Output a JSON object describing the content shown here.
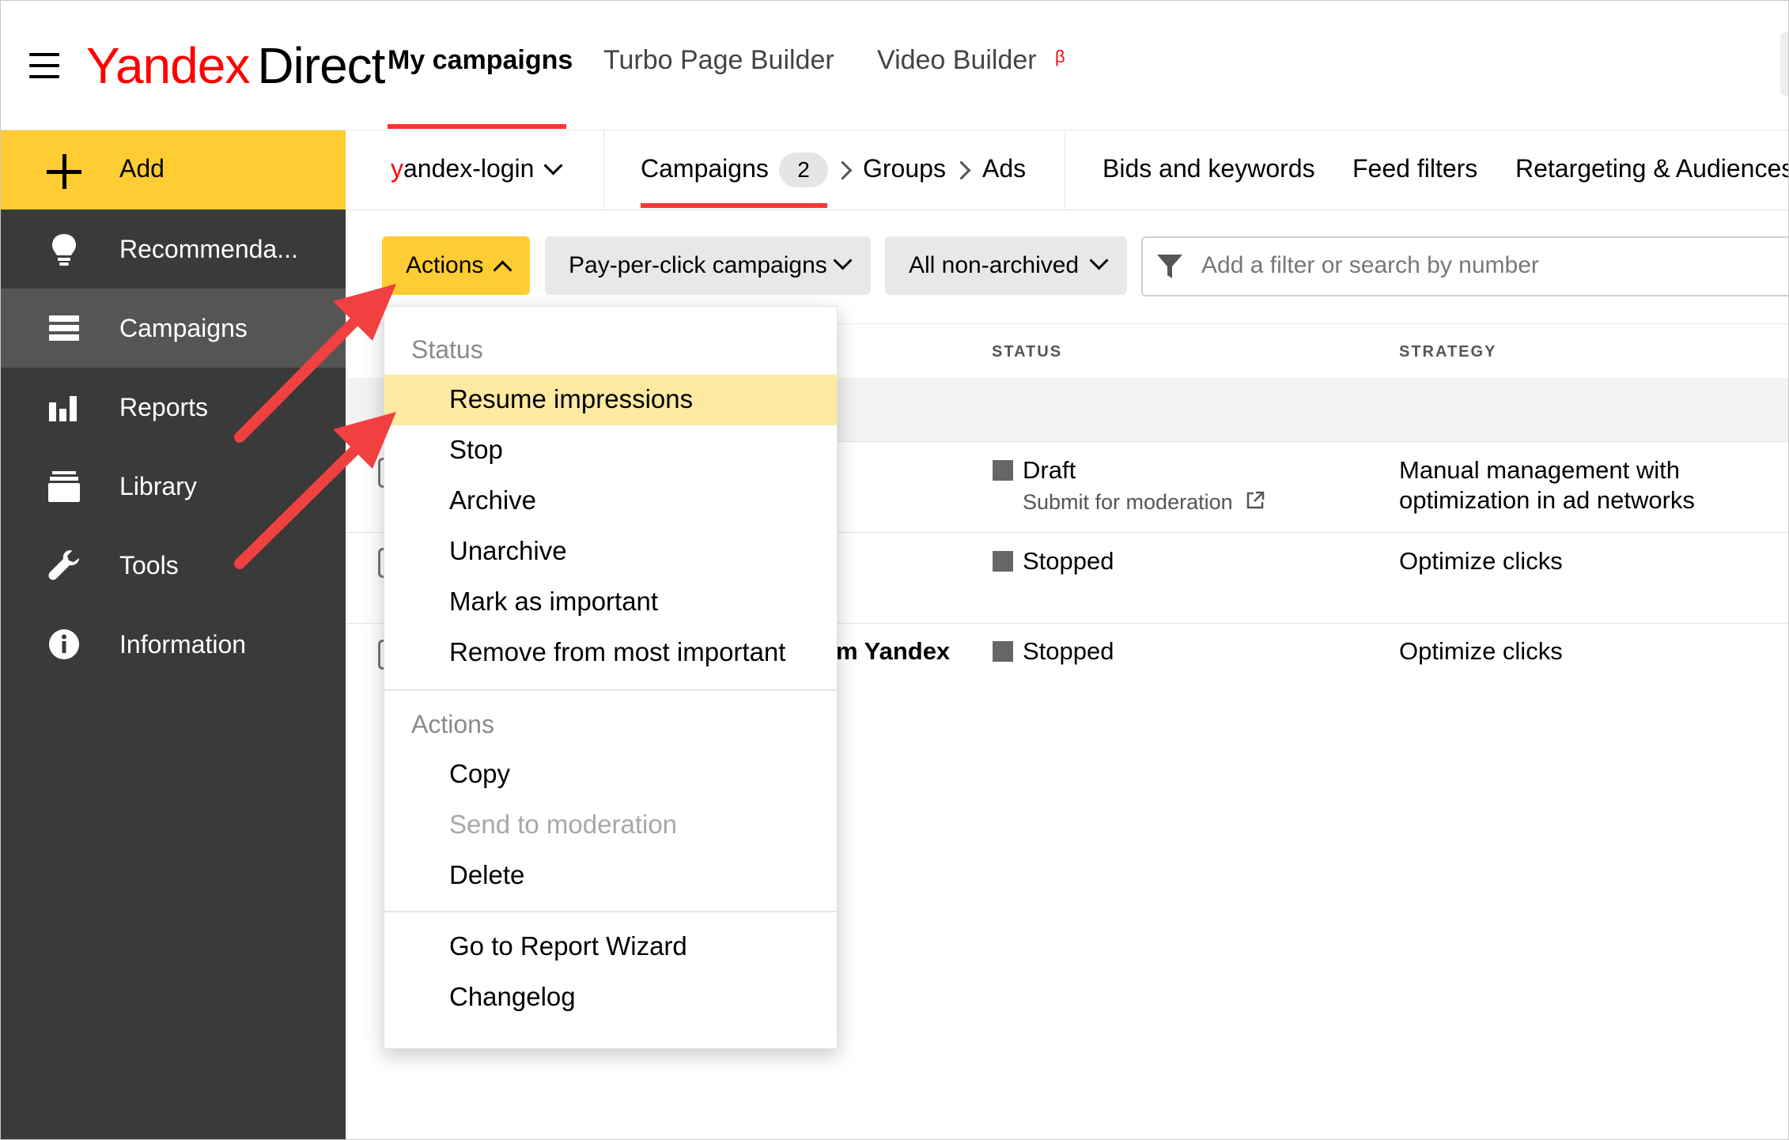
{
  "header": {
    "logo_yandex": "Yandex",
    "logo_direct": "Direct",
    "tabs": [
      "My campaigns",
      "Turbo Page Builder",
      "Video Builder"
    ],
    "beta_mark": "β"
  },
  "sidebar": {
    "add_label": "Add",
    "items": [
      {
        "label": "Recommenda...",
        "icon": "lightbulb-icon"
      },
      {
        "label": "Campaigns",
        "icon": "list-icon"
      },
      {
        "label": "Reports",
        "icon": "bar-chart-icon"
      },
      {
        "label": "Library",
        "icon": "library-icon"
      },
      {
        "label": "Tools",
        "icon": "wrench-icon"
      },
      {
        "label": "Information",
        "icon": "info-icon"
      }
    ]
  },
  "subbar": {
    "login_first": "y",
    "login_rest": "andex-login",
    "campaigns": "Campaigns",
    "campaigns_count": "2",
    "groups": "Groups",
    "ads": "Ads",
    "bids": "Bids and keywords",
    "feed_filters": "Feed filters",
    "retargeting": "Retargeting & Audiences"
  },
  "toolbar": {
    "actions_label": "Actions",
    "campaign_type": "Pay-per-click campaigns",
    "archive_filter": "All non-archived",
    "search_placeholder": "Add a filter or search by number"
  },
  "table": {
    "headers": {
      "status": "STATUS",
      "strategy": "STRATEGY"
    },
    "rows": [
      {
        "name": "",
        "status": "Draft",
        "status_sub": "Submit for moderation",
        "strategy_line1": "Manual management with",
        "strategy_line2": "optimization in ad networks"
      },
      {
        "name": "",
        "status": "Stopped",
        "strategy_line1": "Optimize clicks"
      },
      {
        "name": "m Yandex",
        "status": "Stopped",
        "strategy_line1": "Optimize clicks"
      }
    ]
  },
  "menu": {
    "status_group": "Status",
    "status_items": [
      "Resume impressions",
      "Stop",
      "Archive",
      "Unarchive",
      "Mark as important",
      "Remove from most important"
    ],
    "actions_group": "Actions",
    "actions_items": [
      "Copy",
      "Send to moderation",
      "Delete"
    ],
    "other_items": [
      "Go to Report Wizard",
      "Changelog"
    ]
  },
  "colors": {
    "accent_yellow": "#ffcc33",
    "highlight": "#fde9a0",
    "brand_red": "#ff3333",
    "sidebar_bg": "#3a3a3a",
    "arrow_red": "#f04040"
  }
}
